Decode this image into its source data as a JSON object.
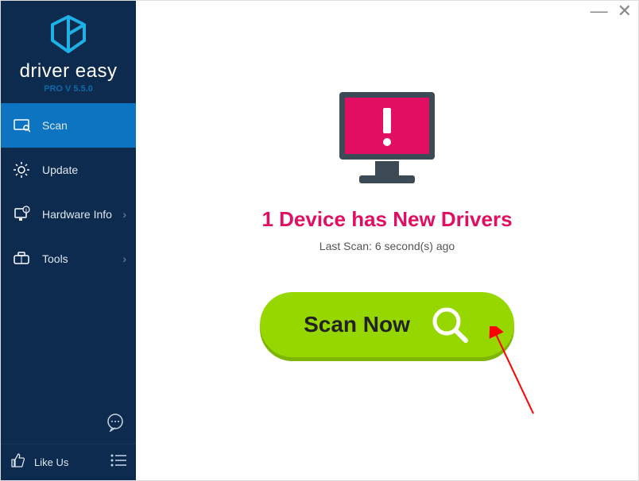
{
  "app": {
    "name": "driver easy",
    "version": "PRO V 5.5.0"
  },
  "sidebar": {
    "items": [
      {
        "label": "Scan"
      },
      {
        "label": "Update"
      },
      {
        "label": "Hardware Info"
      },
      {
        "label": "Tools"
      }
    ],
    "like_label": "Like Us"
  },
  "main": {
    "status_title": "1 Device has New Drivers",
    "last_scan": "Last Scan: 6 second(s) ago",
    "scan_button_label": "Scan Now"
  },
  "colors": {
    "sidebar_bg": "#0d2a4f",
    "sidebar_active": "#0d74c2",
    "accent_pink": "#e20e62",
    "scan_green": "#97d700",
    "arrow_red": "#ff0000"
  }
}
